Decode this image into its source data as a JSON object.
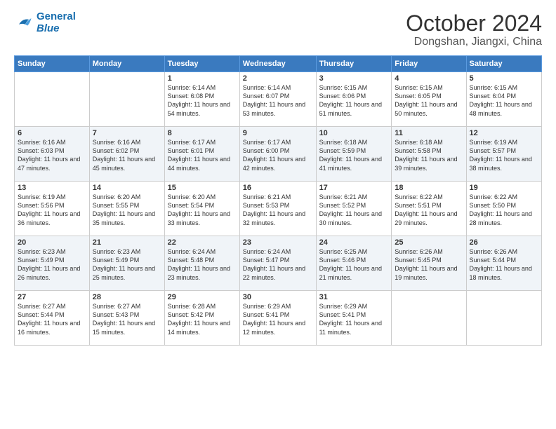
{
  "logo": {
    "line1": "General",
    "line2": "Blue"
  },
  "title": "October 2024",
  "location": "Dongshan, Jiangxi, China",
  "weekdays": [
    "Sunday",
    "Monday",
    "Tuesday",
    "Wednesday",
    "Thursday",
    "Friday",
    "Saturday"
  ],
  "weeks": [
    [
      null,
      null,
      {
        "day": 1,
        "sunrise": "6:14 AM",
        "sunset": "6:08 PM",
        "daylight": "11 hours and 54 minutes."
      },
      {
        "day": 2,
        "sunrise": "6:14 AM",
        "sunset": "6:07 PM",
        "daylight": "11 hours and 53 minutes."
      },
      {
        "day": 3,
        "sunrise": "6:15 AM",
        "sunset": "6:06 PM",
        "daylight": "11 hours and 51 minutes."
      },
      {
        "day": 4,
        "sunrise": "6:15 AM",
        "sunset": "6:05 PM",
        "daylight": "11 hours and 50 minutes."
      },
      {
        "day": 5,
        "sunrise": "6:15 AM",
        "sunset": "6:04 PM",
        "daylight": "11 hours and 48 minutes."
      }
    ],
    [
      {
        "day": 6,
        "sunrise": "6:16 AM",
        "sunset": "6:03 PM",
        "daylight": "11 hours and 47 minutes."
      },
      {
        "day": 7,
        "sunrise": "6:16 AM",
        "sunset": "6:02 PM",
        "daylight": "11 hours and 45 minutes."
      },
      {
        "day": 8,
        "sunrise": "6:17 AM",
        "sunset": "6:01 PM",
        "daylight": "11 hours and 44 minutes."
      },
      {
        "day": 9,
        "sunrise": "6:17 AM",
        "sunset": "6:00 PM",
        "daylight": "11 hours and 42 minutes."
      },
      {
        "day": 10,
        "sunrise": "6:18 AM",
        "sunset": "5:59 PM",
        "daylight": "11 hours and 41 minutes."
      },
      {
        "day": 11,
        "sunrise": "6:18 AM",
        "sunset": "5:58 PM",
        "daylight": "11 hours and 39 minutes."
      },
      {
        "day": 12,
        "sunrise": "6:19 AM",
        "sunset": "5:57 PM",
        "daylight": "11 hours and 38 minutes."
      }
    ],
    [
      {
        "day": 13,
        "sunrise": "6:19 AM",
        "sunset": "5:56 PM",
        "daylight": "11 hours and 36 minutes."
      },
      {
        "day": 14,
        "sunrise": "6:20 AM",
        "sunset": "5:55 PM",
        "daylight": "11 hours and 35 minutes."
      },
      {
        "day": 15,
        "sunrise": "6:20 AM",
        "sunset": "5:54 PM",
        "daylight": "11 hours and 33 minutes."
      },
      {
        "day": 16,
        "sunrise": "6:21 AM",
        "sunset": "5:53 PM",
        "daylight": "11 hours and 32 minutes."
      },
      {
        "day": 17,
        "sunrise": "6:21 AM",
        "sunset": "5:52 PM",
        "daylight": "11 hours and 30 minutes."
      },
      {
        "day": 18,
        "sunrise": "6:22 AM",
        "sunset": "5:51 PM",
        "daylight": "11 hours and 29 minutes."
      },
      {
        "day": 19,
        "sunrise": "6:22 AM",
        "sunset": "5:50 PM",
        "daylight": "11 hours and 28 minutes."
      }
    ],
    [
      {
        "day": 20,
        "sunrise": "6:23 AM",
        "sunset": "5:49 PM",
        "daylight": "11 hours and 26 minutes."
      },
      {
        "day": 21,
        "sunrise": "6:23 AM",
        "sunset": "5:49 PM",
        "daylight": "11 hours and 25 minutes."
      },
      {
        "day": 22,
        "sunrise": "6:24 AM",
        "sunset": "5:48 PM",
        "daylight": "11 hours and 23 minutes."
      },
      {
        "day": 23,
        "sunrise": "6:24 AM",
        "sunset": "5:47 PM",
        "daylight": "11 hours and 22 minutes."
      },
      {
        "day": 24,
        "sunrise": "6:25 AM",
        "sunset": "5:46 PM",
        "daylight": "11 hours and 21 minutes."
      },
      {
        "day": 25,
        "sunrise": "6:26 AM",
        "sunset": "5:45 PM",
        "daylight": "11 hours and 19 minutes."
      },
      {
        "day": 26,
        "sunrise": "6:26 AM",
        "sunset": "5:44 PM",
        "daylight": "11 hours and 18 minutes."
      }
    ],
    [
      {
        "day": 27,
        "sunrise": "6:27 AM",
        "sunset": "5:44 PM",
        "daylight": "11 hours and 16 minutes."
      },
      {
        "day": 28,
        "sunrise": "6:27 AM",
        "sunset": "5:43 PM",
        "daylight": "11 hours and 15 minutes."
      },
      {
        "day": 29,
        "sunrise": "6:28 AM",
        "sunset": "5:42 PM",
        "daylight": "11 hours and 14 minutes."
      },
      {
        "day": 30,
        "sunrise": "6:29 AM",
        "sunset": "5:41 PM",
        "daylight": "11 hours and 12 minutes."
      },
      {
        "day": 31,
        "sunrise": "6:29 AM",
        "sunset": "5:41 PM",
        "daylight": "11 hours and 11 minutes."
      },
      null,
      null
    ]
  ]
}
